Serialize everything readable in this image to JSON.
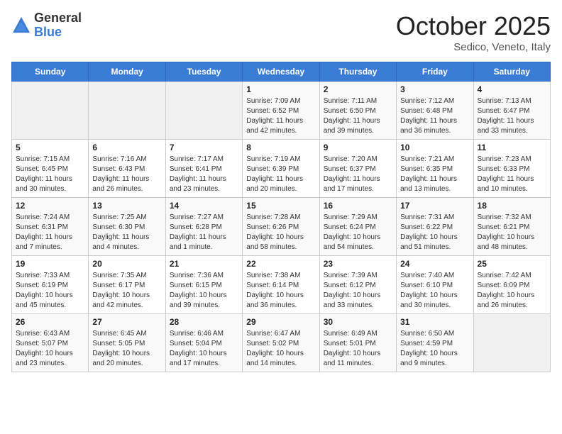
{
  "header": {
    "logo_general": "General",
    "logo_blue": "Blue",
    "month": "October 2025",
    "location": "Sedico, Veneto, Italy"
  },
  "weekdays": [
    "Sunday",
    "Monday",
    "Tuesday",
    "Wednesday",
    "Thursday",
    "Friday",
    "Saturday"
  ],
  "weeks": [
    [
      {
        "day": "",
        "info": ""
      },
      {
        "day": "",
        "info": ""
      },
      {
        "day": "",
        "info": ""
      },
      {
        "day": "1",
        "info": "Sunrise: 7:09 AM\nSunset: 6:52 PM\nDaylight: 11 hours\nand 42 minutes."
      },
      {
        "day": "2",
        "info": "Sunrise: 7:11 AM\nSunset: 6:50 PM\nDaylight: 11 hours\nand 39 minutes."
      },
      {
        "day": "3",
        "info": "Sunrise: 7:12 AM\nSunset: 6:48 PM\nDaylight: 11 hours\nand 36 minutes."
      },
      {
        "day": "4",
        "info": "Sunrise: 7:13 AM\nSunset: 6:47 PM\nDaylight: 11 hours\nand 33 minutes."
      }
    ],
    [
      {
        "day": "5",
        "info": "Sunrise: 7:15 AM\nSunset: 6:45 PM\nDaylight: 11 hours\nand 30 minutes."
      },
      {
        "day": "6",
        "info": "Sunrise: 7:16 AM\nSunset: 6:43 PM\nDaylight: 11 hours\nand 26 minutes."
      },
      {
        "day": "7",
        "info": "Sunrise: 7:17 AM\nSunset: 6:41 PM\nDaylight: 11 hours\nand 23 minutes."
      },
      {
        "day": "8",
        "info": "Sunrise: 7:19 AM\nSunset: 6:39 PM\nDaylight: 11 hours\nand 20 minutes."
      },
      {
        "day": "9",
        "info": "Sunrise: 7:20 AM\nSunset: 6:37 PM\nDaylight: 11 hours\nand 17 minutes."
      },
      {
        "day": "10",
        "info": "Sunrise: 7:21 AM\nSunset: 6:35 PM\nDaylight: 11 hours\nand 13 minutes."
      },
      {
        "day": "11",
        "info": "Sunrise: 7:23 AM\nSunset: 6:33 PM\nDaylight: 11 hours\nand 10 minutes."
      }
    ],
    [
      {
        "day": "12",
        "info": "Sunrise: 7:24 AM\nSunset: 6:31 PM\nDaylight: 11 hours\nand 7 minutes."
      },
      {
        "day": "13",
        "info": "Sunrise: 7:25 AM\nSunset: 6:30 PM\nDaylight: 11 hours\nand 4 minutes."
      },
      {
        "day": "14",
        "info": "Sunrise: 7:27 AM\nSunset: 6:28 PM\nDaylight: 11 hours\nand 1 minute."
      },
      {
        "day": "15",
        "info": "Sunrise: 7:28 AM\nSunset: 6:26 PM\nDaylight: 10 hours\nand 58 minutes."
      },
      {
        "day": "16",
        "info": "Sunrise: 7:29 AM\nSunset: 6:24 PM\nDaylight: 10 hours\nand 54 minutes."
      },
      {
        "day": "17",
        "info": "Sunrise: 7:31 AM\nSunset: 6:22 PM\nDaylight: 10 hours\nand 51 minutes."
      },
      {
        "day": "18",
        "info": "Sunrise: 7:32 AM\nSunset: 6:21 PM\nDaylight: 10 hours\nand 48 minutes."
      }
    ],
    [
      {
        "day": "19",
        "info": "Sunrise: 7:33 AM\nSunset: 6:19 PM\nDaylight: 10 hours\nand 45 minutes."
      },
      {
        "day": "20",
        "info": "Sunrise: 7:35 AM\nSunset: 6:17 PM\nDaylight: 10 hours\nand 42 minutes."
      },
      {
        "day": "21",
        "info": "Sunrise: 7:36 AM\nSunset: 6:15 PM\nDaylight: 10 hours\nand 39 minutes."
      },
      {
        "day": "22",
        "info": "Sunrise: 7:38 AM\nSunset: 6:14 PM\nDaylight: 10 hours\nand 36 minutes."
      },
      {
        "day": "23",
        "info": "Sunrise: 7:39 AM\nSunset: 6:12 PM\nDaylight: 10 hours\nand 33 minutes."
      },
      {
        "day": "24",
        "info": "Sunrise: 7:40 AM\nSunset: 6:10 PM\nDaylight: 10 hours\nand 30 minutes."
      },
      {
        "day": "25",
        "info": "Sunrise: 7:42 AM\nSunset: 6:09 PM\nDaylight: 10 hours\nand 26 minutes."
      }
    ],
    [
      {
        "day": "26",
        "info": "Sunrise: 6:43 AM\nSunset: 5:07 PM\nDaylight: 10 hours\nand 23 minutes."
      },
      {
        "day": "27",
        "info": "Sunrise: 6:45 AM\nSunset: 5:05 PM\nDaylight: 10 hours\nand 20 minutes."
      },
      {
        "day": "28",
        "info": "Sunrise: 6:46 AM\nSunset: 5:04 PM\nDaylight: 10 hours\nand 17 minutes."
      },
      {
        "day": "29",
        "info": "Sunrise: 6:47 AM\nSunset: 5:02 PM\nDaylight: 10 hours\nand 14 minutes."
      },
      {
        "day": "30",
        "info": "Sunrise: 6:49 AM\nSunset: 5:01 PM\nDaylight: 10 hours\nand 11 minutes."
      },
      {
        "day": "31",
        "info": "Sunrise: 6:50 AM\nSunset: 4:59 PM\nDaylight: 10 hours\nand 9 minutes."
      },
      {
        "day": "",
        "info": ""
      }
    ]
  ]
}
